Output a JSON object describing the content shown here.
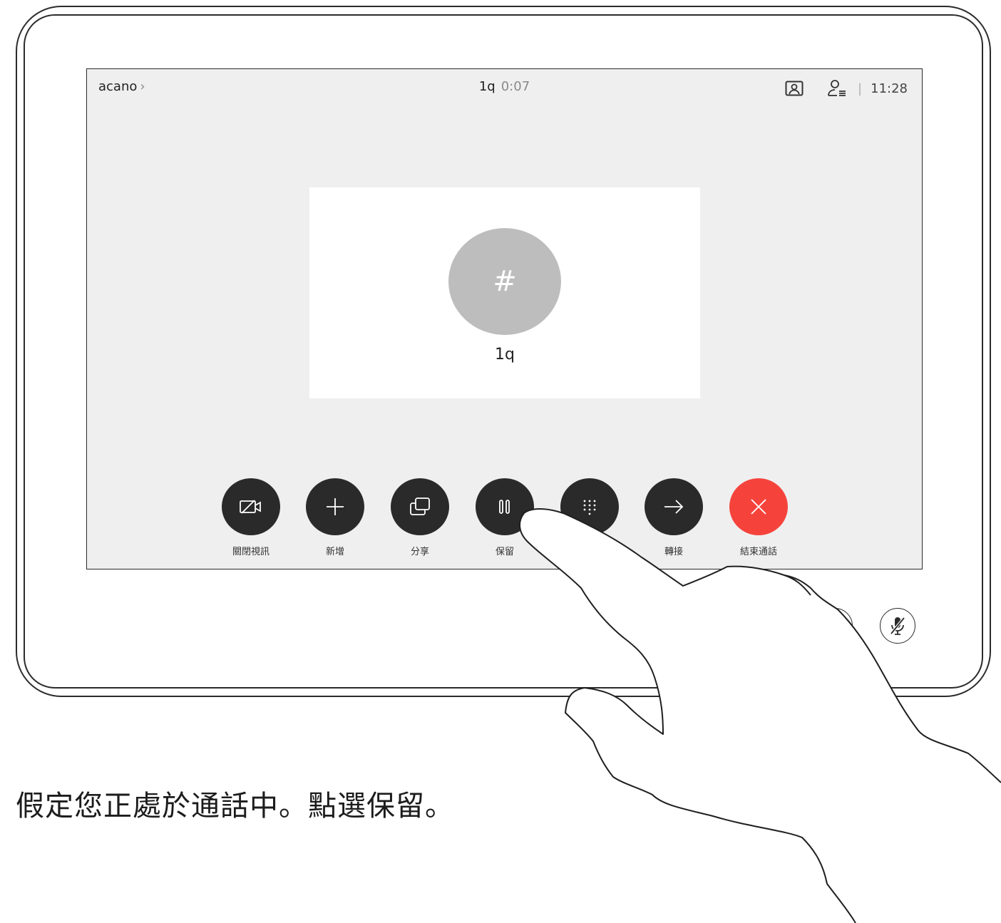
{
  "topbar": {
    "breadcrumb": "acano",
    "breadcrumb_chevron": "›",
    "call_name": "1q",
    "call_timer": "0:07",
    "clock": "11:28",
    "separator": "|",
    "icons": [
      "self-view-icon",
      "participants-icon"
    ]
  },
  "participant": {
    "avatar_glyph": "#",
    "name": "1q"
  },
  "controls": [
    {
      "label": "關閉視訊",
      "icon": "video-off-icon"
    },
    {
      "label": "新增",
      "icon": "plus-icon"
    },
    {
      "label": "分享",
      "icon": "share-icon"
    },
    {
      "label": "保留",
      "icon": "hold-icon"
    },
    {
      "label": "",
      "icon": "keypad-icon"
    },
    {
      "label": "轉接",
      "icon": "transfer-arrow-icon"
    },
    {
      "label": "結束通話",
      "icon": "end-call-icon"
    }
  ],
  "colors": {
    "screen_bg": "#efefef",
    "button_dark": "#2a2a2a",
    "end_call": "#f5433c",
    "avatar": "#bdbdbd"
  },
  "caption": "假定您正處於通話中。點選保留。"
}
